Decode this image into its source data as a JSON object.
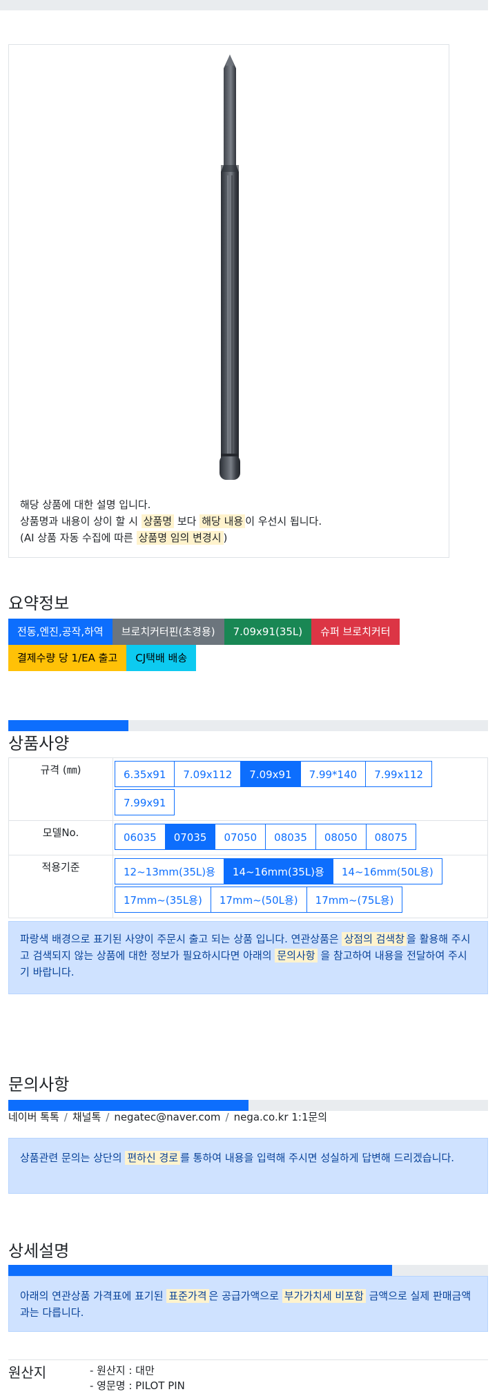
{
  "image_note": {
    "line1": "해당 상품에 대한 설명 입니다.",
    "line2_a": "상품명과 내용이 상이 할 시",
    "line2_hl1": "상품명",
    "line2_b": "보다",
    "line2_hl2": "해당 내용",
    "line2_c": "이 우선시 됩니다.",
    "line3_a": "(AI 상품 자동 수집에 따른",
    "line3_hl": "상품명 임의 변경시",
    "line3_b": ")"
  },
  "summary": {
    "title": "요약정보",
    "badges": [
      "전동,엔진,공작,하역",
      "브로치커터핀(초경용)",
      "7.09x91(35L)",
      "슈퍼 브로치커터",
      "결제수량 당 1/EA 출고",
      "CJ택배 배송"
    ]
  },
  "progress": {
    "spec": 0.25,
    "inquiry": 0.5,
    "detail": 0.8
  },
  "spec": {
    "title": "상품사양",
    "rows": [
      {
        "label": "규격 (㎜)",
        "options": [
          "6.35x91",
          "7.09x112",
          "7.09x91",
          "7.99*140",
          "7.99x112",
          "7.99x91"
        ],
        "selected": 2
      },
      {
        "label": "모델No.",
        "options": [
          "06035",
          "07035",
          "07050",
          "08035",
          "08050",
          "08075"
        ],
        "selected": 1
      },
      {
        "label": "적용기준",
        "options": [
          "12~13mm(35L)용",
          "14~16mm(35L)용",
          "14~16mm(50L용)",
          "17mm~(35L용)",
          "17mm~(50L용)",
          "17mm~(75L용)"
        ],
        "selected": 1
      }
    ],
    "alert_a": "파랑색 배경으로 표기된 사양이 주문시 출고 되는 상품 입니다. 연관상품은",
    "alert_hl1": "상점의 검색창",
    "alert_b": "을 활용해 주시고 검색되지 않는 상품에 대한 정보가 필요하시다면 아래의",
    "alert_hl2": "문의사항",
    "alert_c": "을 참고하여 내용을 전달하여 주시기 바랍니다."
  },
  "inquiry": {
    "title": "문의사항",
    "contacts": [
      "네이버 톡톡",
      "채널톡",
      "negatec@naver.com",
      "nega.co.kr 1:1문의"
    ],
    "separator": "/",
    "alert_a": "상품관련 문의는 상단의",
    "alert_hl": "편하신 경로",
    "alert_b": "를 통하여 내용을 입력해 주시면 성실하게 답변해 드리겠습니다."
  },
  "detail": {
    "title": "상세설명",
    "alert_a": "아래의 연관상품 가격표에 표기된",
    "alert_hl1": "표준가격",
    "alert_b": "은 공급가액으로",
    "alert_hl2": "부가가치세 비포함",
    "alert_c": "금액으로 실제 판매금액과는 다릅니다."
  },
  "origin": {
    "title": "원산지",
    "lines": [
      "- 원산지 : 대만",
      "- 영문명 : PILOT PIN"
    ]
  }
}
